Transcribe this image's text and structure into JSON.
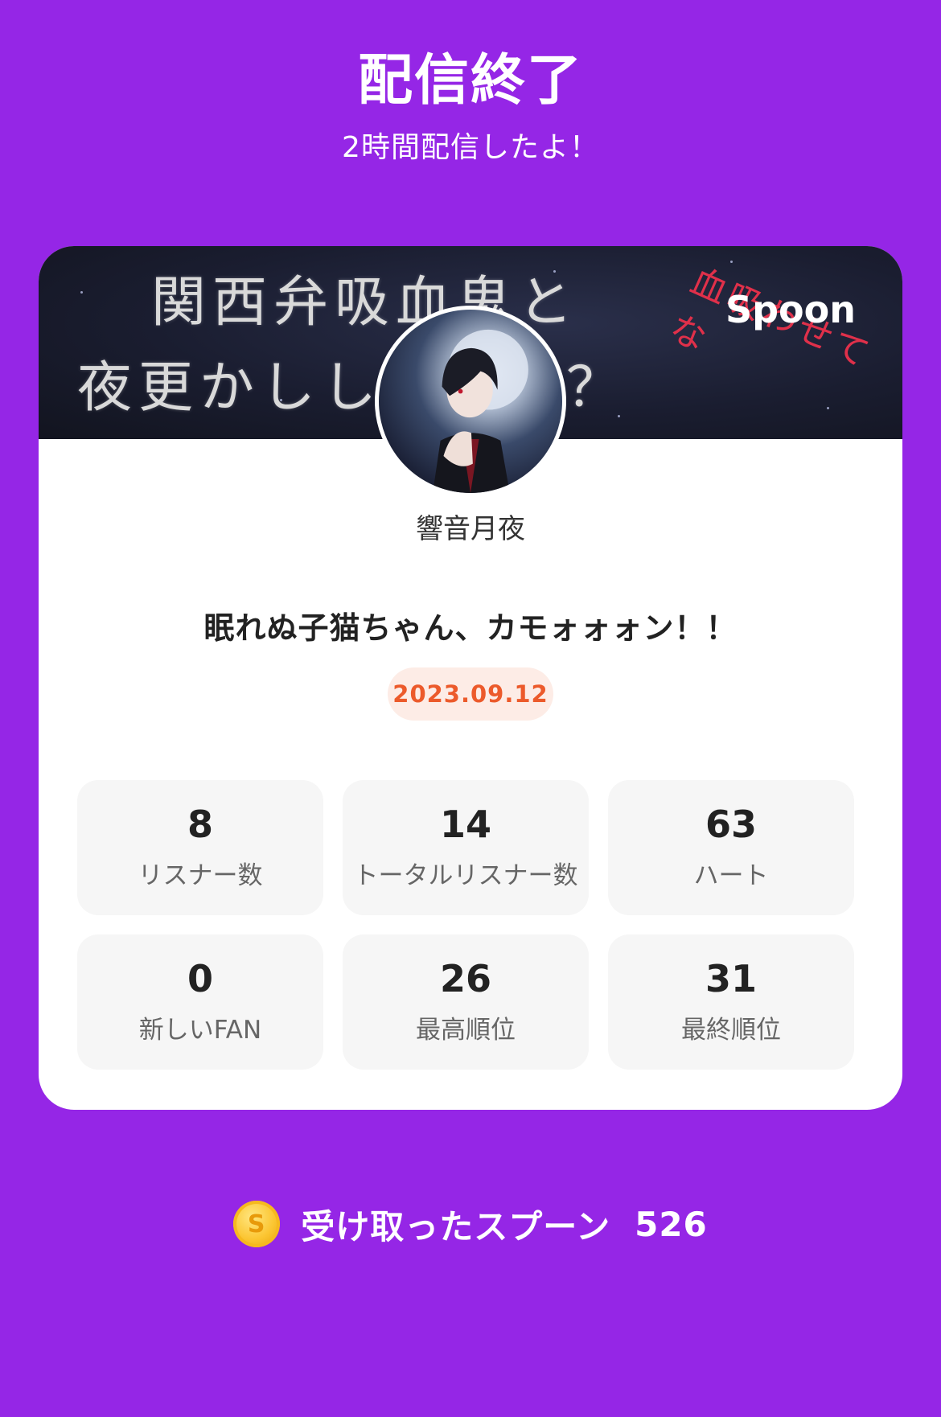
{
  "header": {
    "title": "配信終了",
    "subtitle": "2時間配信したよ！"
  },
  "card": {
    "banner": {
      "line1": "関西弁吸血鬼と",
      "line2": "夜更かしし　　か？",
      "red_text": "血吸わせてな",
      "logo": "Spoon"
    },
    "dj_name": "響音月夜",
    "live_title": "眠れぬ子猫ちゃん、カモォォォン！！",
    "date": "2023.09.12",
    "stats": [
      {
        "value": "8",
        "label": "リスナー数"
      },
      {
        "value": "14",
        "label": "トータルリスナー数"
      },
      {
        "value": "63",
        "label": "ハート"
      },
      {
        "value": "0",
        "label": "新しいFAN"
      },
      {
        "value": "26",
        "label": "最高順位"
      },
      {
        "value": "31",
        "label": "最終順位"
      }
    ]
  },
  "spoons": {
    "icon": "spoon-coin-icon",
    "coin_glyph": "S",
    "label": "受け取ったスプーン",
    "count": "526"
  },
  "colors": {
    "background": "#9526e6",
    "card": "#ffffff",
    "date_badge_bg": "#fdece6",
    "date_badge_text": "#ec5a2b",
    "stat_bg": "#f6f6f6",
    "coin": "#fbc531"
  }
}
